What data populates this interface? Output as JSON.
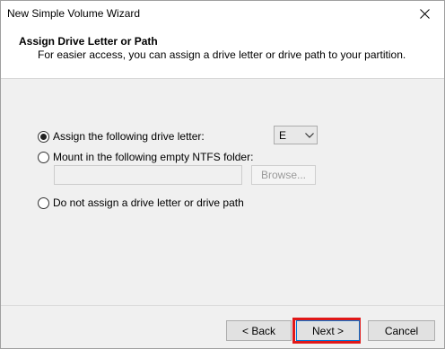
{
  "window": {
    "title": "New Simple Volume Wizard"
  },
  "header": {
    "title": "Assign Drive Letter or Path",
    "subtitle": "For easier access, you can assign a drive letter or drive path to your partition."
  },
  "options": {
    "assign_letter": {
      "label": "Assign the following drive letter:",
      "checked": true
    },
    "mount_folder": {
      "label": "Mount in the following empty NTFS folder:",
      "checked": false
    },
    "no_assign": {
      "label": "Do not assign a drive letter or drive path",
      "checked": false
    }
  },
  "drive_letter": {
    "selected": "E"
  },
  "folder_path": {
    "value": ""
  },
  "buttons": {
    "browse": "Browse...",
    "back": "< Back",
    "next": "Next >",
    "cancel": "Cancel"
  },
  "colors": {
    "highlight": "#e01818",
    "focus_border": "#0078d7"
  }
}
